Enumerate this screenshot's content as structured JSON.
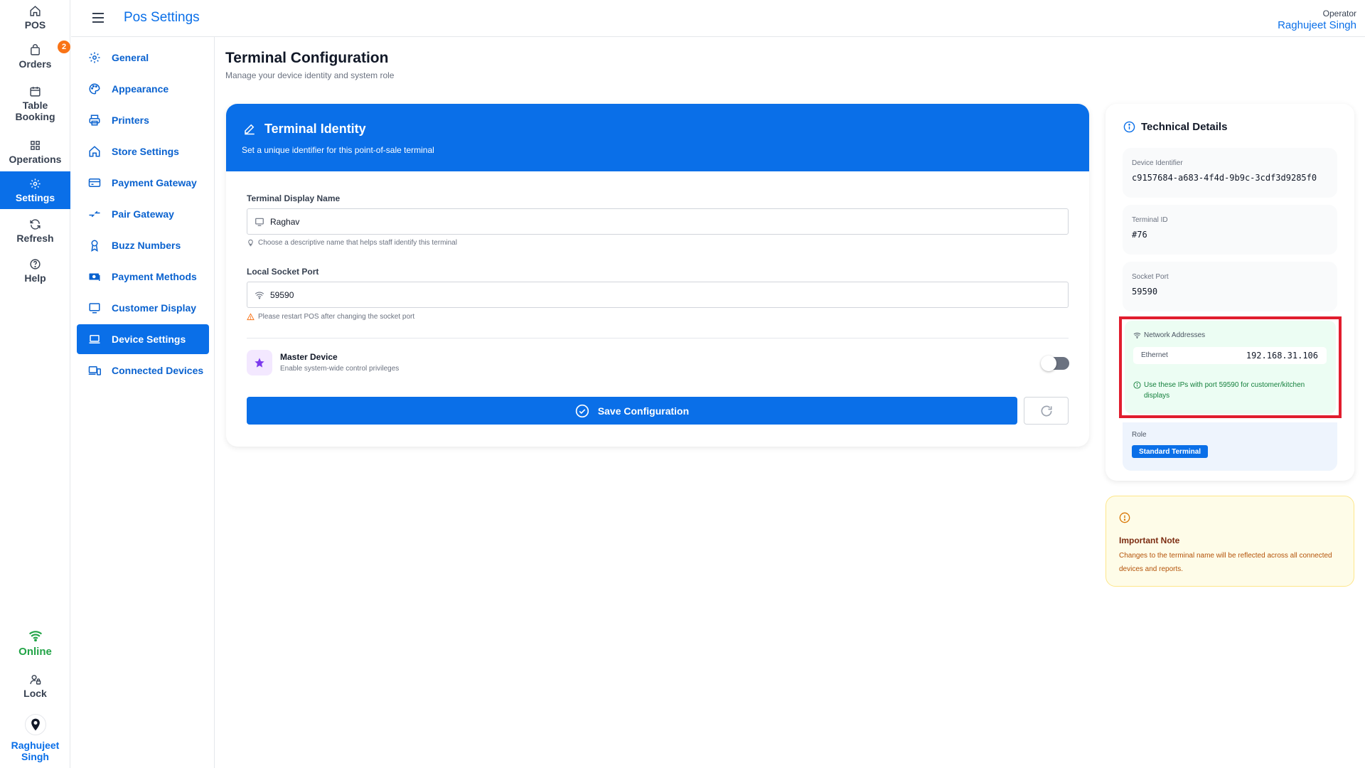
{
  "rail": {
    "items": [
      {
        "label": "POS",
        "icon": "home-icon"
      },
      {
        "label": "Orders",
        "icon": "bag-icon",
        "badge": "2"
      },
      {
        "label": "Table\nBooking",
        "icon": "calendar-icon"
      },
      {
        "label": "Operations",
        "icon": "grid-icon"
      },
      {
        "label": "Settings",
        "icon": "gear-icon",
        "active": true
      },
      {
        "label": "Refresh",
        "icon": "refresh-icon"
      },
      {
        "label": "Help",
        "icon": "help-icon"
      }
    ],
    "status": "Online",
    "lock_label": "Lock",
    "user_name": "Raghujeet Singh"
  },
  "topbar": {
    "title": "Pos Settings",
    "operator_label": "Operator",
    "operator_name": "Raghujeet Singh"
  },
  "subnav": {
    "items": [
      {
        "label": "General",
        "icon": "gear-icon"
      },
      {
        "label": "Appearance",
        "icon": "palette-icon"
      },
      {
        "label": "Printers",
        "icon": "printer-icon"
      },
      {
        "label": "Store Settings",
        "icon": "store-icon"
      },
      {
        "label": "Payment Gateway",
        "icon": "card-icon"
      },
      {
        "label": "Pair Gateway",
        "icon": "arrows-icon"
      },
      {
        "label": "Buzz Numbers",
        "icon": "ribbon-icon"
      },
      {
        "label": "Payment Methods",
        "icon": "cash-icon"
      },
      {
        "label": "Customer Display",
        "icon": "monitor-icon"
      },
      {
        "label": "Device Settings",
        "icon": "laptop-icon",
        "active": true
      },
      {
        "label": "Connected Devices",
        "icon": "devices-icon"
      }
    ]
  },
  "page": {
    "title": "Terminal Configuration",
    "subtitle": "Manage your device identity and system role"
  },
  "identity": {
    "title": "Terminal Identity",
    "subtitle": "Set a unique identifier for this point-of-sale terminal",
    "name_label": "Terminal Display Name",
    "name_value": "Raghav",
    "name_hint": "Choose a descriptive name that helps staff identify this terminal",
    "port_label": "Local Socket Port",
    "port_value": "59590",
    "port_hint": "Please restart POS after changing the socket port",
    "master_title": "Master Device",
    "master_sub": "Enable system-wide control privileges",
    "master_enabled": false,
    "save_label": "Save Configuration"
  },
  "tech": {
    "title": "Technical Details",
    "device_identifier_label": "Device Identifier",
    "device_identifier": "c9157684-a683-4f4d-9b9c-3cdf3d9285f0",
    "terminal_id_label": "Terminal ID",
    "terminal_id": "#76",
    "socket_port_label": "Socket Port",
    "socket_port": "59590",
    "network_label": "Network Addresses",
    "ethernet_label": "Ethernet",
    "ethernet_ip": "192.168.31.106",
    "network_note": "Use these IPs with port 59590 for customer/kitchen displays",
    "role_label": "Role",
    "role_value": "Standard Terminal"
  },
  "note": {
    "title": "Important Note",
    "body": "Changes to the terminal name will be reflected across all connected devices and reports."
  },
  "colors": {
    "accent": "#0a6fe8",
    "online": "#22a447",
    "highlight": "#e11d2e",
    "badge": "#f97316"
  }
}
